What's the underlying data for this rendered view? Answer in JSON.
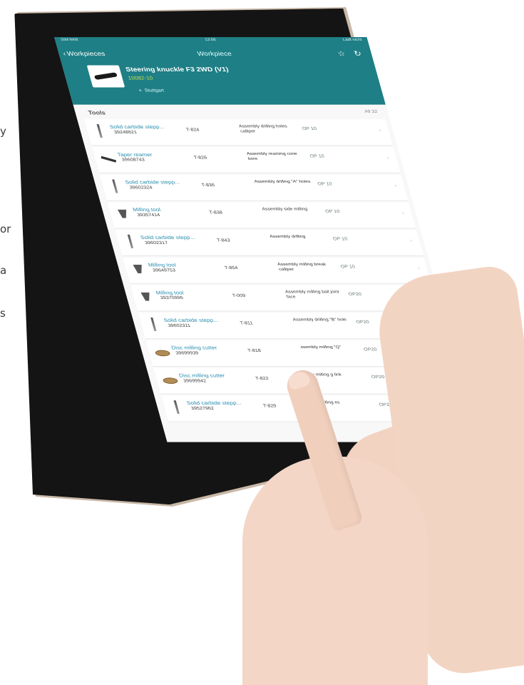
{
  "edge_text": [
    "y",
    "or",
    "a",
    "s"
  ],
  "status_bar": {
    "carrier": "SIM fehlt",
    "time": "13:06",
    "battery": "Lädt nicht"
  },
  "nav": {
    "back_label": "Workpieces",
    "title": "Workpiece"
  },
  "workpiece": {
    "name": "Steering knuckle F3 2WD (V1)",
    "id": "10082-10",
    "location": "Stuttgart"
  },
  "tools": {
    "heading": "Tools",
    "all_label": "All 32",
    "rows": [
      {
        "name": "Solid carbide stepp...",
        "number": "39248621",
        "tcode": "T-824",
        "desc": "Assembly drilling holes calliper",
        "op": "OP 10",
        "icon": "drill"
      },
      {
        "name": "Taper reamer",
        "number": "39608743",
        "tcode": "T-826",
        "desc": "Assembly reaming cone bore",
        "op": "OP 10",
        "icon": "reamer"
      },
      {
        "name": "Solid carbide stepp...",
        "number": "39602324",
        "tcode": "T-836",
        "desc": "Assembly drilling \"A\" holes",
        "op": "OP 10",
        "icon": "drill"
      },
      {
        "name": "Milling tool",
        "number": "39357414",
        "tcode": "T-838",
        "desc": "Assembly side milling",
        "op": "OP 10",
        "icon": "mill"
      },
      {
        "name": "Solid carbide stepp...",
        "number": "39602317",
        "tcode": "T-843",
        "desc": "Assembly drilling",
        "op": "OP 10",
        "icon": "drill"
      },
      {
        "name": "Milling tool",
        "number": "39649753",
        "tcode": "T-854",
        "desc": "Assembly milling break calliper",
        "op": "OP 10",
        "icon": "mill"
      },
      {
        "name": "Milling tool",
        "number": "39370996",
        "tcode": "T-009",
        "desc": "Assembly milling ball joint face",
        "op": "OP20",
        "icon": "mill"
      },
      {
        "name": "Solid carbide stepp...",
        "number": "39602311",
        "tcode": "T-811",
        "desc": "Assembly drilling \"B\" hole",
        "op": "OP20",
        "icon": "drill"
      },
      {
        "name": "Disc milling cutter",
        "number": "39699939",
        "tcode": "T-818",
        "desc": "ssembly milling \"Q\"",
        "op": "OP20",
        "icon": "disc"
      },
      {
        "name": "Disc milling cutter",
        "number": "39699942",
        "tcode": "T-822",
        "desc": "bly milling g link",
        "op": "OP20",
        "icon": "disc"
      },
      {
        "name": "Solid carbide stepp...",
        "number": "39527962",
        "tcode": "T-829",
        "desc": "y drilling es",
        "op": "OP20",
        "icon": "drill"
      }
    ]
  }
}
